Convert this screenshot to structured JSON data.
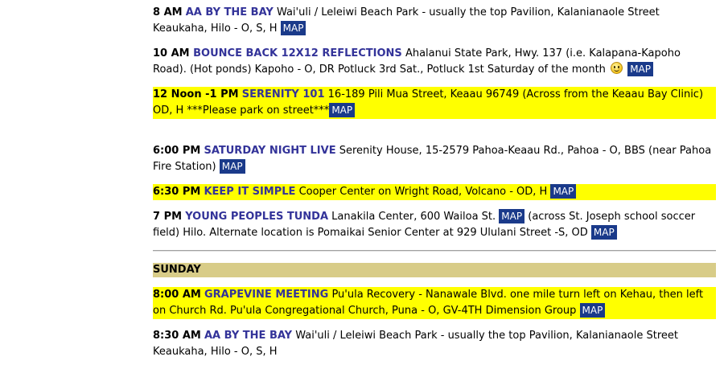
{
  "entries": [
    {
      "time": "8 AM",
      "name": "AA BY THE BAY",
      "details": "Wai'uli / Leleiwi Beach Park - usually the top Pavilion, Kalanianaole Street Keaukaha, Hilo - O, S, H",
      "map_label": "MAP"
    },
    {
      "time": "10 AM ",
      "name": "BOUNCE BACK 12X12 REFLECTIONS",
      "details": "Ahalanui State Park, Hwy. 137 (i.e. Kalapana-Kapoho Road). (Hot ponds) Kapoho - O, DR Potluck 3rd Sat., Potluck 1st  Saturday of the month",
      "icon": "smiley-icon",
      "map_label": "MAP"
    },
    {
      "time": "12 Noon -1 PM",
      "name": "SERENITY 101",
      "details": "16-189 Pili Mua Street, Keaau 96749 (Across from the Keaau Bay Clinic) OD, H ***Please park on street***",
      "map_label": "MAP"
    },
    {
      "time": "6:00 PM",
      "name": "SATURDAY NIGHT LIVE",
      "details": "Serenity House, 15-2579 Pahoa-Keaau Rd., Pahoa - O, BBS (near Pahoa Fire Station)",
      "map_label": "MAP"
    },
    {
      "time": "6:30 PM",
      "name": "KEEP IT SIMPLE",
      "details": "Cooper Center on Wright Road, Volcano - OD, H",
      "map_label": "MAP"
    },
    {
      "time": "7 PM",
      "name": "YOUNG PEOPLES TUNDA",
      "details_before_map": "Lanakila Center, 600 Wailoa St.",
      "map_label": "MAP",
      "details_after_map": "(across St. Joseph school soccer field) Hilo. Alternate location is Pomaikai Senior Center at 929 Ululani Street -S, OD",
      "map_label_2": "MAP"
    }
  ],
  "day_header": "SUNDAY",
  "sunday_entries": [
    {
      "time": "8:00 AM",
      "name": "GRAPEVINE MEETING",
      "details": "Pu'ula Recovery - Nanawale Blvd. one mile turn left on Kehau, then left on Church Rd. Pu'ula Congregational Church, Puna - O, GV-4TH Dimension Group",
      "map_label": "MAP"
    },
    {
      "time": "8:30 AM",
      "name": "AA BY THE BAY",
      "details": "Wai'uli / Leleiwi Beach Park - usually the top Pavilion, Kalanianaole Street Keaukaha, Hilo - O, S, H"
    }
  ],
  "colors": {
    "meeting_name": "#333399",
    "highlight": "#ffff00",
    "map_button_bg": "#1a3a8a",
    "day_header_bg": "#d8cc88"
  }
}
